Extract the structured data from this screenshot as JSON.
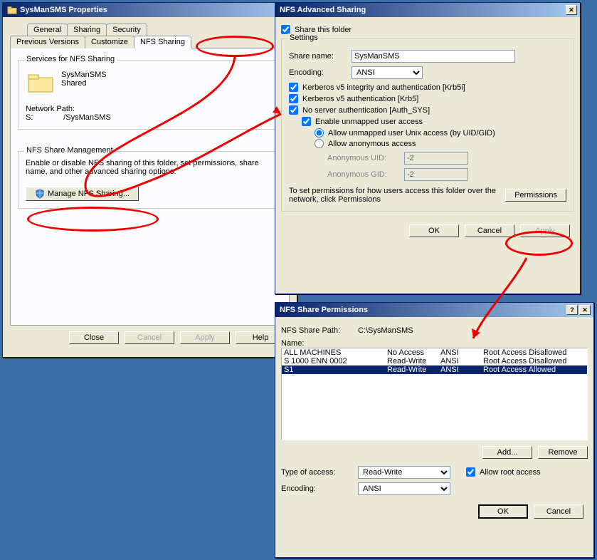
{
  "properties_window": {
    "title": "SysManSMS Properties",
    "tabs": {
      "general": "General",
      "sharing": "Sharing",
      "security": "Security",
      "previous": "Previous Versions",
      "customize": "Customize",
      "nfs": "NFS Sharing"
    },
    "services_group": "Services for NFS Sharing",
    "folder_name": "SysManSMS",
    "folder_status": "Shared",
    "network_path_label": "Network Path:",
    "network_path_value": "S:              /SysManSMS",
    "mgmt_group": "NFS Share Management",
    "mgmt_text": "Enable or disable NFS sharing of this folder, set permissions, share name, and other advanced sharing options.",
    "manage_btn": "Manage NFS Sharing...",
    "buttons": {
      "close": "Close",
      "cancel": "Cancel",
      "apply": "Apply",
      "help": "Help"
    }
  },
  "advanced_window": {
    "title": "NFS Advanced Sharing",
    "share_folder": "Share this folder",
    "settings_group": "Settings",
    "share_name_label": "Share name:",
    "share_name_value": "SysManSMS",
    "encoding_label": "Encoding:",
    "encoding_value": "ANSI",
    "krb5i": "Kerberos v5 integrity and authentication [Krb5i]",
    "krb5": "Kerberos v5 authentication [Krb5]",
    "authsys": "No server authentication [Auth_SYS]",
    "unmapped": "Enable unmapped user access",
    "allow_uidgid": "Allow unmapped user Unix access (by UID/GID)",
    "allow_anon": "Allow anonymous access",
    "anon_uid_label": "Anonymous UID:",
    "anon_uid_value": "-2",
    "anon_gid_label": "Anonymous GID:",
    "anon_gid_value": "-2",
    "perm_text": "To set permissions for how users access this folder over the network, click Permissions",
    "permissions_btn": "Permissions",
    "ok": "OK",
    "cancel": "Cancel",
    "apply": "Apply"
  },
  "perms_window": {
    "title": "NFS Share Permissions",
    "path_label": "NFS Share Path:",
    "path_value": "C:\\SysManSMS",
    "name_label": "Name:",
    "rows": [
      {
        "n": "ALL MACHINES",
        "a": "No Access",
        "e": "ANSI",
        "r": "Root Access Disallowed"
      },
      {
        "n": "S 1000 ENN 0002",
        "a": "Read-Write",
        "e": "ANSI",
        "r": "Root Access Disallowed"
      },
      {
        "n": "S1",
        "a": "Read-Write",
        "e": "ANSI",
        "r": "Root Access Allowed"
      }
    ],
    "add": "Add...",
    "remove": "Remove",
    "type_label": "Type of access:",
    "type_value": "Read-Write",
    "allow_root": "Allow root access",
    "encoding_label": "Encoding:",
    "encoding_value": "ANSI",
    "ok": "OK",
    "cancel": "Cancel"
  }
}
